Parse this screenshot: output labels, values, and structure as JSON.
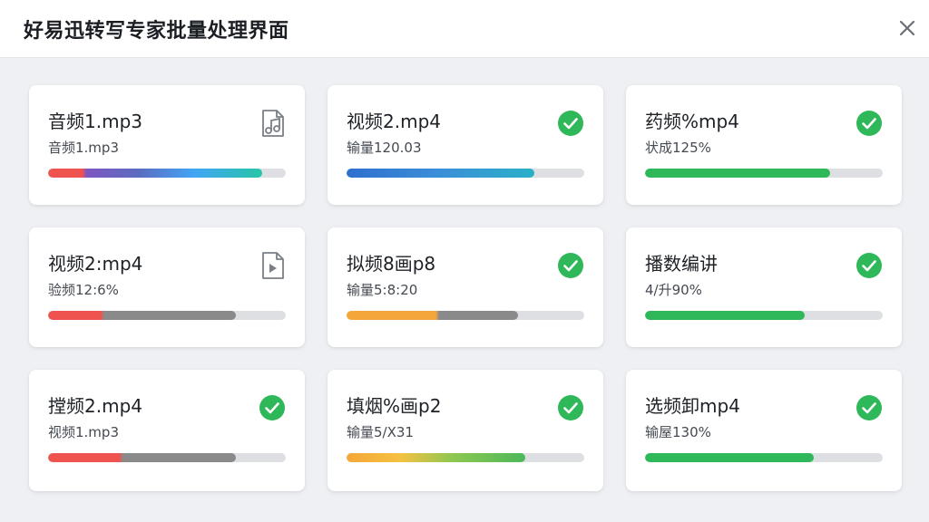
{
  "window": {
    "title": "好易迅转写专家批量处理界面"
  },
  "cards": [
    {
      "name": "音频1.mp3",
      "status": "音频1.mp3",
      "icon": "music-file-icon",
      "progress": 0.9,
      "fill": "linear-gradient(90deg,#ef5350 0%,#ef5350 16%,#7e57c2 18%,#5c6bc0 42%,#42a5f5 68%,#26c6a8 100%)"
    },
    {
      "name": "视频2.mp4",
      "status": "输量120.03",
      "icon": "check-circle-icon",
      "progress": 0.79,
      "fill": "linear-gradient(90deg,#2f6fcf 0%,#3b8fd8 50%,#2ab0c8 100%)"
    },
    {
      "name": "药频%mp4",
      "status": "状成125%",
      "icon": "check-circle-icon",
      "progress": 0.78,
      "fill": "#2fb85a"
    },
    {
      "name": "视频2:mp4",
      "status": "验频12:6%",
      "icon": "video-file-icon",
      "progress": 0.79,
      "fill": "linear-gradient(90deg,#ef5350 0%,#ef5350 28%,#8a8a8a 30%,#8a8a8a 100%)"
    },
    {
      "name": "拟频8画p8",
      "status": "输量5:8:20",
      "icon": "check-circle-icon",
      "progress": 0.72,
      "fill": "linear-gradient(90deg,#f5a638 0%,#f5a638 52%,#8a8a8a 54%,#8a8a8a 100%)"
    },
    {
      "name": "播数编讲",
      "status": "4/升90%",
      "icon": "check-circle-icon",
      "progress": 0.67,
      "fill": "#2fb85a"
    },
    {
      "name": "摚频2.mp4",
      "status": "视频1.mp3",
      "icon": "check-circle-icon",
      "progress": 0.79,
      "fill": "linear-gradient(90deg,#ef5350 0%,#ef5350 38%,#8a8a8a 40%,#8a8a8a 100%)"
    },
    {
      "name": "填烟%画p2",
      "status": "输量5/X31",
      "icon": "check-circle-icon",
      "progress": 0.75,
      "fill": "linear-gradient(90deg,#f5a638 0%,#f5c142 30%,#8cc751 60%,#4cb85a 100%)"
    },
    {
      "name": "选频卸mp4",
      "status": "输屋130%",
      "icon": "check-circle-icon",
      "progress": 0.71,
      "fill": "#2fb85a"
    }
  ],
  "colors": {
    "success": "#2fb85a",
    "background": "#eef0f3",
    "card": "#ffffff",
    "track": "#dddfe2"
  }
}
